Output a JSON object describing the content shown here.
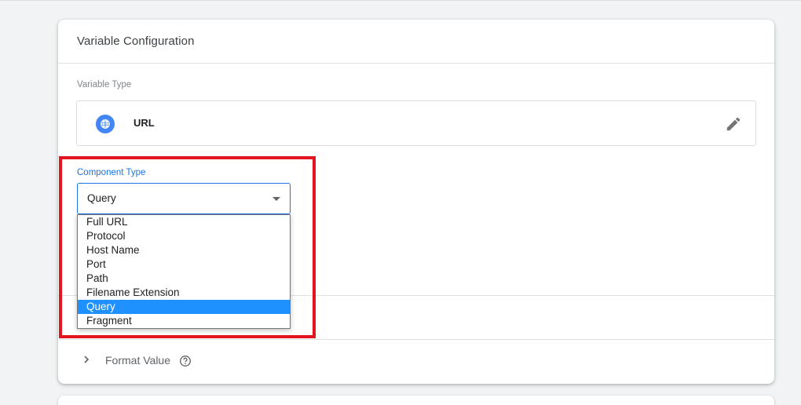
{
  "card": {
    "title": "Variable Configuration",
    "variable_type_label": "Variable Type",
    "variable_type_value": "URL",
    "component_type_label": "Component Type",
    "component_type_value": "Query"
  },
  "dropdown": {
    "options": [
      "Full URL",
      "Protocol",
      "Host Name",
      "Port",
      "Path",
      "Filename Extension",
      "Query",
      "Fragment"
    ],
    "selected_index": 6
  },
  "format": {
    "label": "Format Value"
  },
  "icons": {
    "variable_type": "globe-icon",
    "edit": "pencil-icon",
    "expand": "chevron-right-icon",
    "help": "help-circle-icon",
    "select_arrow": "dropdown-arrow-icon"
  },
  "colors": {
    "accent": "#1a73e8",
    "highlight_border": "#e1141f",
    "selected_option": "#1e90ff"
  }
}
